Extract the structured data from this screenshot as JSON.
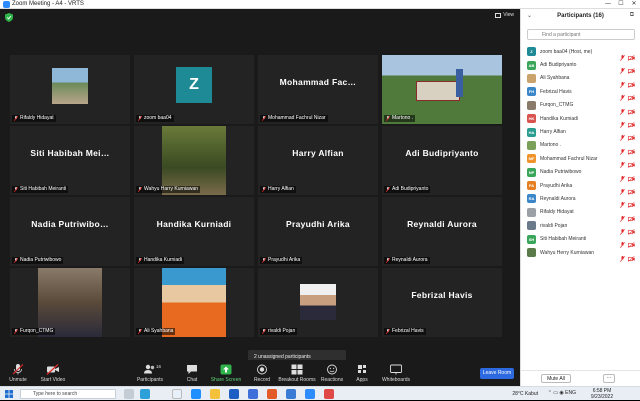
{
  "window": {
    "title": "Zoom Meeting - A4 - VRTS",
    "minimize": "—",
    "maximize": "☐",
    "close": "✕"
  },
  "view_button": "View",
  "tiles": [
    {
      "name": "Rifaldy Hidayat",
      "big": "",
      "kind": "photo"
    },
    {
      "name": "zoom baa04",
      "big": "",
      "kind": "avatar",
      "initial": "Z"
    },
    {
      "name": "Mohammad Fachrul Nizar",
      "big": "Mohammad  Fac…",
      "kind": "text"
    },
    {
      "name": "Martono .",
      "big": "",
      "kind": "video",
      "active": true
    },
    {
      "name": "Siti Habibah Meiranti",
      "big": "Siti  Habibah  Mei…",
      "kind": "text"
    },
    {
      "name": "Wahyu Harry Kurniawan",
      "big": "",
      "kind": "photo"
    },
    {
      "name": "Harry Alfian",
      "big": "Harry  Alfian",
      "kind": "text"
    },
    {
      "name": "Adi Budipriyanto",
      "big": "Adi  Budipriyanto",
      "kind": "text"
    },
    {
      "name": "Nadia Putriwibowo",
      "big": "Nadia  Putriwibo…",
      "kind": "text"
    },
    {
      "name": "Handika Kurniadi",
      "big": "Handika  Kurniadi",
      "kind": "text"
    },
    {
      "name": "Prayudhi Arika",
      "big": "Prayudhi  Arika",
      "kind": "text"
    },
    {
      "name": "Reynaldi Aurora",
      "big": "Reynaldi  Aurora",
      "kind": "text"
    },
    {
      "name": "Furqon_CTMG",
      "big": "",
      "kind": "photo"
    },
    {
      "name": "Ali Syahbana",
      "big": "",
      "kind": "photo"
    },
    {
      "name": "rivaldi Pojan",
      "big": "",
      "kind": "photo"
    },
    {
      "name": "Febrizal Havis",
      "big": "Febrizal  Havis",
      "kind": "text"
    }
  ],
  "unassigned": "2 unassigned participants",
  "toolbar": {
    "unmute": "Unmute",
    "start_video": "Start Video",
    "participants": "Participants",
    "participants_count": "16",
    "chat": "Chat",
    "share_screen": "Share Screen",
    "record": "Record",
    "breakout_rooms": "Breakout Rooms",
    "reactions": "Reactions",
    "apps": "Apps",
    "whiteboards": "Whiteboards",
    "leave": "Leave Room"
  },
  "panel": {
    "title": "Participants (16)",
    "search_placeholder": "Find a participant",
    "mute_all": "Mute All",
    "more": "···",
    "participants": [
      {
        "initials": "Z",
        "name": "zoom baa04 (Host, me)",
        "color": "#1e8a96"
      },
      {
        "initials": "AB",
        "name": "Adi Budipriyanto",
        "color": "#3aa65a"
      },
      {
        "initials": "",
        "name": "Ali Syahbana",
        "color": "#c9a36b"
      },
      {
        "initials": "FH",
        "name": "Febrizal Havis",
        "color": "#3a86c9"
      },
      {
        "initials": "",
        "name": "Furqon_CTMG",
        "color": "#8a7a6a"
      },
      {
        "initials": "HK",
        "name": "Handika Kurniadi",
        "color": "#d9534f"
      },
      {
        "initials": "HA",
        "name": "Harry Alfian",
        "color": "#2a9d8f"
      },
      {
        "initials": "",
        "name": "Martono .",
        "color": "#7aa05a"
      },
      {
        "initials": "MF",
        "name": "Mohammad Fachrul Nizar",
        "color": "#f0932b"
      },
      {
        "initials": "NP",
        "name": "Nadia Putriwibowo",
        "color": "#3aa65a"
      },
      {
        "initials": "PA",
        "name": "Prayudhi Arika",
        "color": "#e67e22"
      },
      {
        "initials": "RA",
        "name": "Reynaldi Aurora",
        "color": "#3a86c9"
      },
      {
        "initials": "",
        "name": "Rifaldy Hidayat",
        "color": "#9aa0a6"
      },
      {
        "initials": "",
        "name": "rivaldi Pojan",
        "color": "#6b7a8a"
      },
      {
        "initials": "SH",
        "name": "Siti Habibah Meiranti",
        "color": "#3aa65a"
      },
      {
        "initials": "",
        "name": "Wahyu Herry Kurniawan",
        "color": "#5a7a4a"
      }
    ]
  },
  "taskbar": {
    "search_placeholder": "Type here to search",
    "weather": "28°C  Kabut",
    "time": "6:58 PM",
    "date": "9/23/2022"
  },
  "colors": {
    "accent": "#2d6ae0",
    "active_speaker": "#e6f05a",
    "muted_red": "#e02828"
  }
}
